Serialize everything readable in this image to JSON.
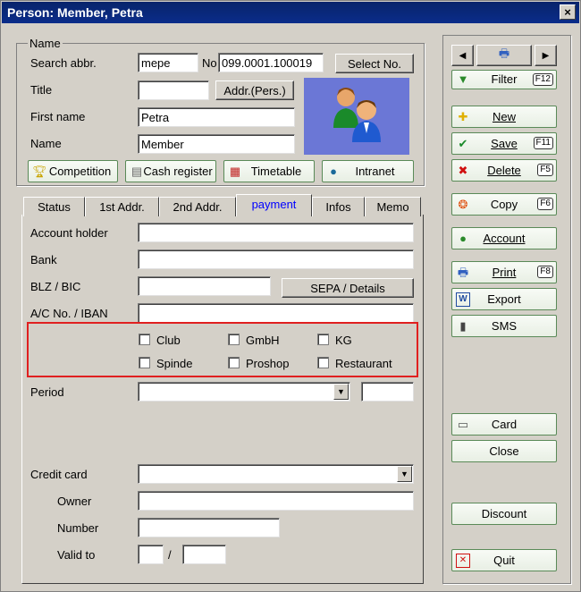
{
  "window": {
    "title": "Person: Member, Petra",
    "close": "×"
  },
  "name_group": {
    "legend": "Name",
    "search_abbr_label": "Search abbr.",
    "search_abbr_value": "mepe",
    "no_label": "No",
    "no_value": "099.0001.100019",
    "select_no": "Select No.",
    "title_label": "Title",
    "title_value": "",
    "addr_pers": "Addr.(Pers.)",
    "firstname_label": "First name",
    "firstname_value": "Petra",
    "name_label": "Name",
    "name_value": "Member"
  },
  "action_buttons": {
    "competition": "Competition",
    "cash_register": "Cash register",
    "timetable": "Timetable",
    "intranet": "Intranet"
  },
  "tabs": [
    "Status",
    "1st Addr.",
    "2nd Addr.",
    "payment",
    "Infos",
    "Memo"
  ],
  "payment": {
    "account_holder": "Account holder",
    "bank": "Bank",
    "blz_bic": "BLZ / BIC",
    "sepa_details": "SEPA / Details",
    "ac_no_iban": "A/C No. / IBAN",
    "checkboxes": [
      "Club",
      "GmbH",
      "KG",
      "Spinde",
      "Proshop",
      "Restaurant"
    ],
    "period": "Period",
    "credit_card": "Credit card",
    "owner": "Owner",
    "number": "Number",
    "valid_to": "Valid to",
    "slash": "/"
  },
  "side": {
    "filter": "Filter",
    "filter_key": "F12",
    "new": "New",
    "save": "Save",
    "save_key": "F11",
    "delete": "Delete",
    "delete_key": "F5",
    "copy": "Copy",
    "copy_key": "F6",
    "account": "Account",
    "print": "Print",
    "print_key": "F8",
    "export": "Export",
    "sms": "SMS",
    "card": "Card",
    "close": "Close",
    "discount": "Discount",
    "quit": "Quit"
  },
  "colors": {
    "title_bar": "#0a246a",
    "highlight_box": "#e02020",
    "tab_active_text": "#0000ff"
  }
}
